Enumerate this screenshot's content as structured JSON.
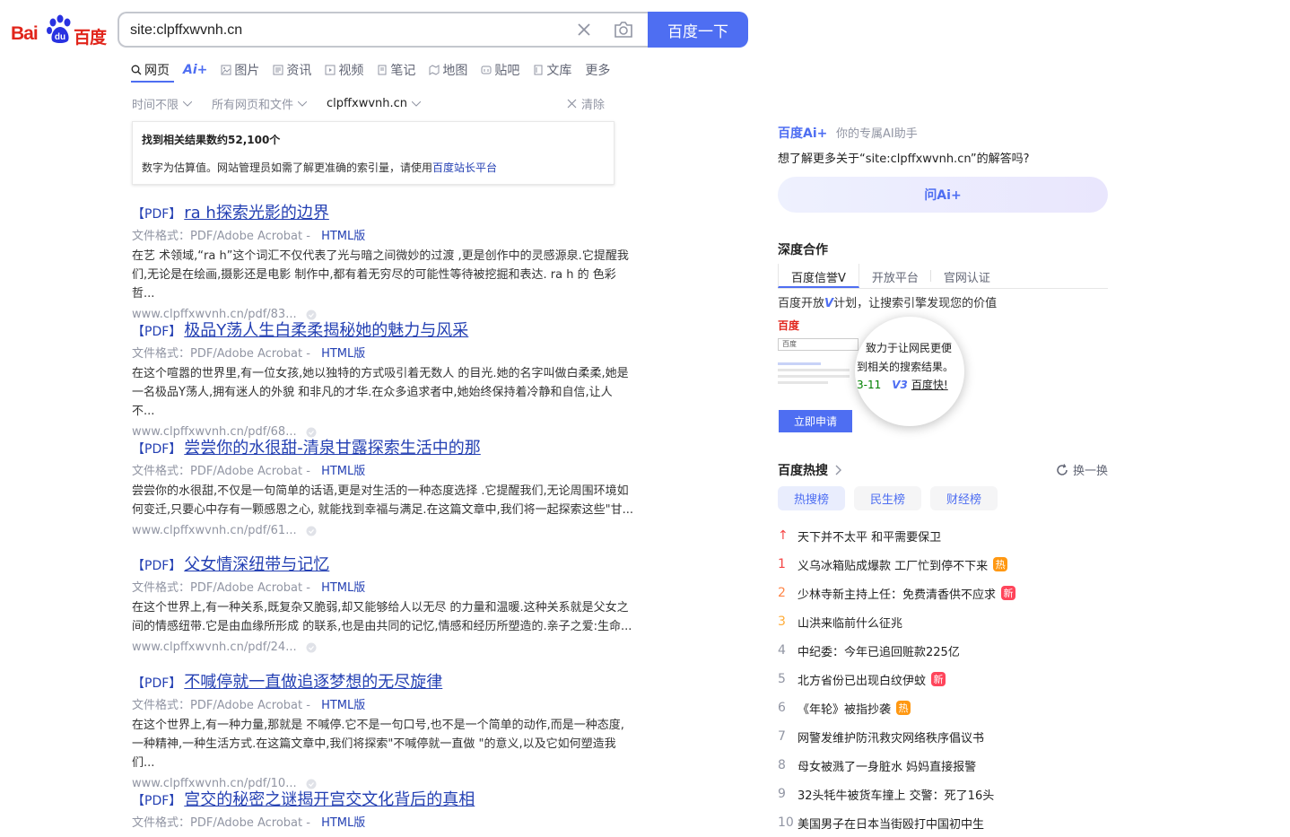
{
  "logo": {
    "bai": "Bai",
    "du": "du",
    "cn": "百度"
  },
  "search": {
    "value": "site:clpffxwvnh.cn",
    "button_label": "百度一下"
  },
  "tabs": [
    {
      "label": "网页",
      "icon": "search-icon"
    },
    {
      "label": "Ai+",
      "icon": ""
    },
    {
      "label": "图片",
      "icon": "image-icon"
    },
    {
      "label": "资讯",
      "icon": "news-icon"
    },
    {
      "label": "视频",
      "icon": "video-icon"
    },
    {
      "label": "笔记",
      "icon": "note-icon"
    },
    {
      "label": "地图",
      "icon": "map-icon"
    },
    {
      "label": "贴吧",
      "icon": "tieba-icon"
    },
    {
      "label": "文库",
      "icon": "doc-icon"
    },
    {
      "label": "更多",
      "icon": ""
    }
  ],
  "filters": {
    "time": "时间不限",
    "type": "所有网页和文件",
    "domain": "clpffxwvnh.cn",
    "clear": "清除"
  },
  "count": {
    "title": "找到相关结果数约52,100个",
    "note": "数字为估算值。网站管理员如需了解更准确的索引量，请使用",
    "link": "百度站长平台"
  },
  "results": [
    {
      "tag": "【PDF】",
      "title": "ra h探索光影的边界",
      "meta": "文件格式：PDF/Adobe Acrobat  - ",
      "html": "HTML版",
      "abstract": "在艺 术领域,“ra h”这个词汇不仅代表了光与暗之间微妙的过渡 ,更是创作中的灵感源泉.它提醒我们,无论是在绘画,摄影还是电影 制作中,都有着无穷尽的可能性等待被挖掘和表达. ra h 的 色彩哲...",
      "url": "www.clpffxwvnh.cn/pdf/83..."
    },
    {
      "tag": "【PDF】",
      "title": "极品Y荡人生白柔柔揭秘她的魅力与风采",
      "meta": "文件格式：PDF/Adobe Acrobat  - ",
      "html": "HTML版",
      "abstract": "在这个喧嚣的世界里,有一位女孩,她以独特的方式吸引着无数人 的目光.她的名字叫做白柔柔,她是一名极品Y荡人,拥有迷人的外貌 和非凡的才华.在众多追求者中,她始终保持着冷静和自信,让人不...",
      "url": "www.clpffxwvnh.cn/pdf/68..."
    },
    {
      "tag": "【PDF】",
      "title": "尝尝你的水很甜-清泉甘露探索生活中的那",
      "meta": "文件格式：PDF/Adobe Acrobat  - ",
      "html": "HTML版",
      "abstract": "尝尝你的水很甜,不仅是一句简单的话语,更是对生活的一种态度选择 .它提醒我们,无论周围环境如何变迁,只要心中存有一颗感恩之心, 就能找到幸福与满足.在这篇文章中,我们将一起探索这些\"甘...",
      "url": "www.clpffxwvnh.cn/pdf/61..."
    },
    {
      "tag": "【PDF】",
      "title": "父女情深纽带与记忆",
      "meta": "文件格式：PDF/Adobe Acrobat  - ",
      "html": "HTML版",
      "abstract": "在这个世界上,有一种关系,既复杂又脆弱,却又能够给人以无尽 的力量和温暖.这种关系就是父女之间的情感纽带.它是由血缘所形成 的联系,也是由共同的记忆,情感和经历所塑造的.亲子之爱:生命...",
      "url": "www.clpffxwvnh.cn/pdf/24..."
    },
    {
      "tag": "【PDF】",
      "title": "不喊停就一直做追逐梦想的无尽旋律",
      "meta": "文件格式：PDF/Adobe Acrobat  - ",
      "html": "HTML版",
      "abstract": "在这个世界上,有一种力量,那就是 不喊停.它不是一句口号,也不是一个简单的动作,而是一种态度,一种精神,一种生活方式.在这篇文章中,我们将探索\"不喊停就一直做 \"的意义,以及它如何塑造我们...",
      "url": "www.clpffxwvnh.cn/pdf/10..."
    },
    {
      "tag": "【PDF】",
      "title": "宫交的秘密之谜揭开宫交文化背后的真相",
      "meta": "文件格式：PDF/Adobe Acrobat  - ",
      "html": "HTML版",
      "abstract": "",
      "url": ""
    }
  ],
  "ai": {
    "brand": "百度Ai+",
    "sub": "你的专属AI助手",
    "question": "想了解更多关于“site:clpffxwvnh.cn”的解答吗?",
    "button": "问Ai+"
  },
  "coop": {
    "heading": "深度合作",
    "tabs": [
      "百度信誉V",
      "开放平台",
      "官网认证"
    ],
    "desc_pre": "百度开放",
    "desc_v": "V",
    "desc_post": "计划，让搜索引擎发现您的价值",
    "demo_search": "百度",
    "mag_line1": "致力于让网民更便",
    "mag_line2": "到相关的搜索结果。",
    "mag_date": "3-11",
    "mag_v": "V3",
    "mag_fast": "百度快!",
    "apply": "立即申请"
  },
  "hot": {
    "heading": "百度热搜",
    "refresh": "换一换",
    "tabs": [
      "热搜榜",
      "民生榜",
      "财经榜"
    ],
    "items": [
      {
        "rank": "↑",
        "text": "天下并不太平 和平需要保卫",
        "tag": ""
      },
      {
        "rank": "1",
        "text": "义乌冰箱贴成爆款 工厂忙到停不下来",
        "tag": "热"
      },
      {
        "rank": "2",
        "text": "少林寺新主持上任：免费清香供不应求",
        "tag": "新"
      },
      {
        "rank": "3",
        "text": "山洪来临前什么征兆",
        "tag": ""
      },
      {
        "rank": "4",
        "text": "中纪委：今年已追回赃款225亿",
        "tag": ""
      },
      {
        "rank": "5",
        "text": "北方省份已出现白纹伊蚊",
        "tag": "新"
      },
      {
        "rank": "6",
        "text": "《年轮》被指抄袭",
        "tag": "热"
      },
      {
        "rank": "7",
        "text": "网警发维护防汛救灾网络秩序倡议书",
        "tag": ""
      },
      {
        "rank": "8",
        "text": "母女被溅了一身脏水 妈妈直接报警",
        "tag": ""
      },
      {
        "rank": "9",
        "text": "32头牦牛被货车撞上 交警：死了16头",
        "tag": ""
      },
      {
        "rank": "10",
        "text": "美国男子在日本当街殴打中国初中生",
        "tag": ""
      }
    ]
  },
  "colors": {
    "accent": "#4e6ef2",
    "link": "#2440b3",
    "brand_red": "#e1251b"
  }
}
